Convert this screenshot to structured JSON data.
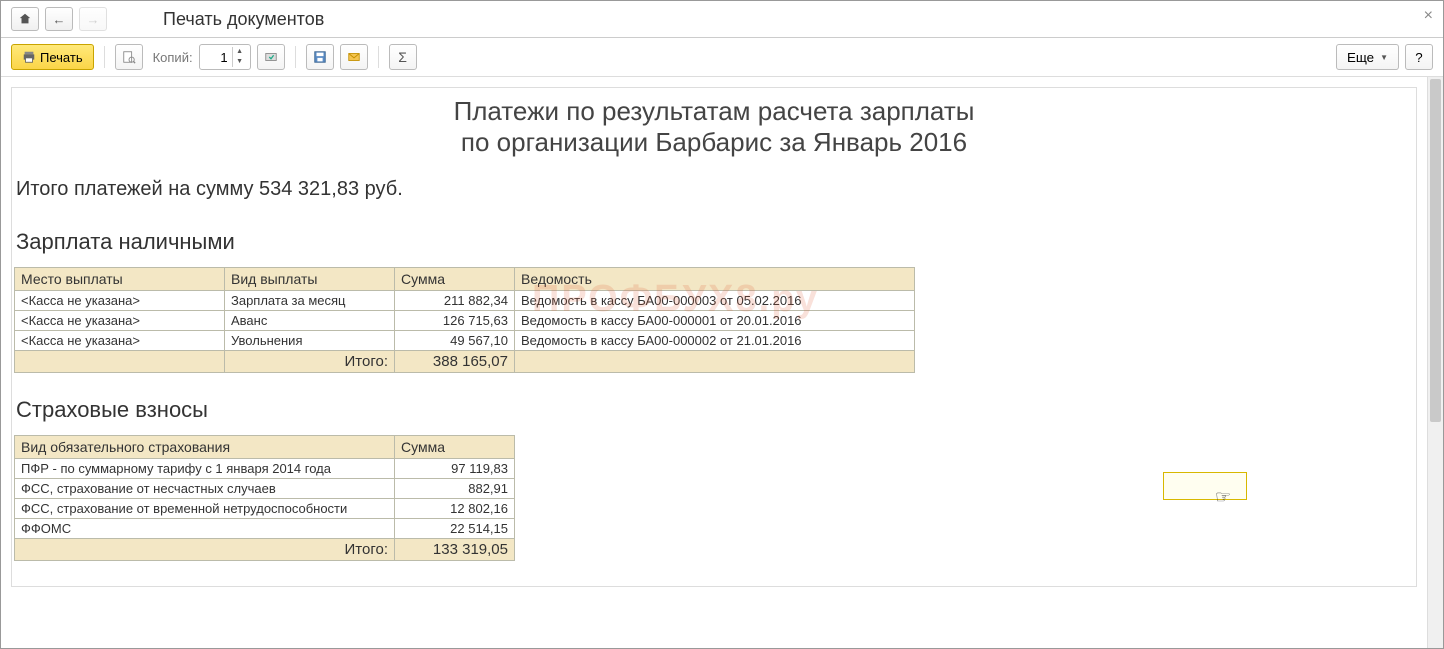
{
  "window": {
    "title": "Печать документов"
  },
  "toolbar": {
    "print": "Печать",
    "copies_label": "Копий:",
    "copies_value": "1",
    "more": "Еще",
    "help": "?"
  },
  "doc": {
    "title1": "Платежи по результатам расчета зарплаты",
    "title2": "по организации Барбарис за Январь 2016",
    "summary": "Итого платежей на сумму 534 321,83 руб.",
    "watermark": "ПРОФБУХ8.ру",
    "section1": "Зарплата наличными",
    "section2": "Страховые взносы"
  },
  "cash": {
    "headers": [
      "Место выплаты",
      "Вид выплаты",
      "Сумма",
      "Ведомость"
    ],
    "rows": [
      {
        "place": "<Касса не указана>",
        "type": "Зарплата за месяц",
        "sum": "211 882,34",
        "sheet": "Ведомость в кассу БА00-000003 от 05.02.2016"
      },
      {
        "place": "<Касса не указана>",
        "type": "Аванс",
        "sum": "126 715,63",
        "sheet": "Ведомость в кассу БА00-000001 от 20.01.2016"
      },
      {
        "place": "<Касса не указана>",
        "type": "Увольнения",
        "sum": "49 567,10",
        "sheet": "Ведомость в кассу БА00-000002 от 21.01.2016"
      }
    ],
    "total_label": "Итого:",
    "total_sum": "388 165,07"
  },
  "ins": {
    "headers": [
      "Вид обязательного страхования",
      "Сумма"
    ],
    "rows": [
      {
        "type": "ПФР - по суммарному тарифу с 1 января 2014 года",
        "sum": "97 119,83"
      },
      {
        "type": "ФСС, страхование от несчастных случаев",
        "sum": "882,91"
      },
      {
        "type": "ФСС, страхование от временной нетрудоспособности",
        "sum": "12 802,16"
      },
      {
        "type": "ФФОМС",
        "sum": "22 514,15"
      }
    ],
    "total_label": "Итого:",
    "total_sum": "133 319,05"
  }
}
